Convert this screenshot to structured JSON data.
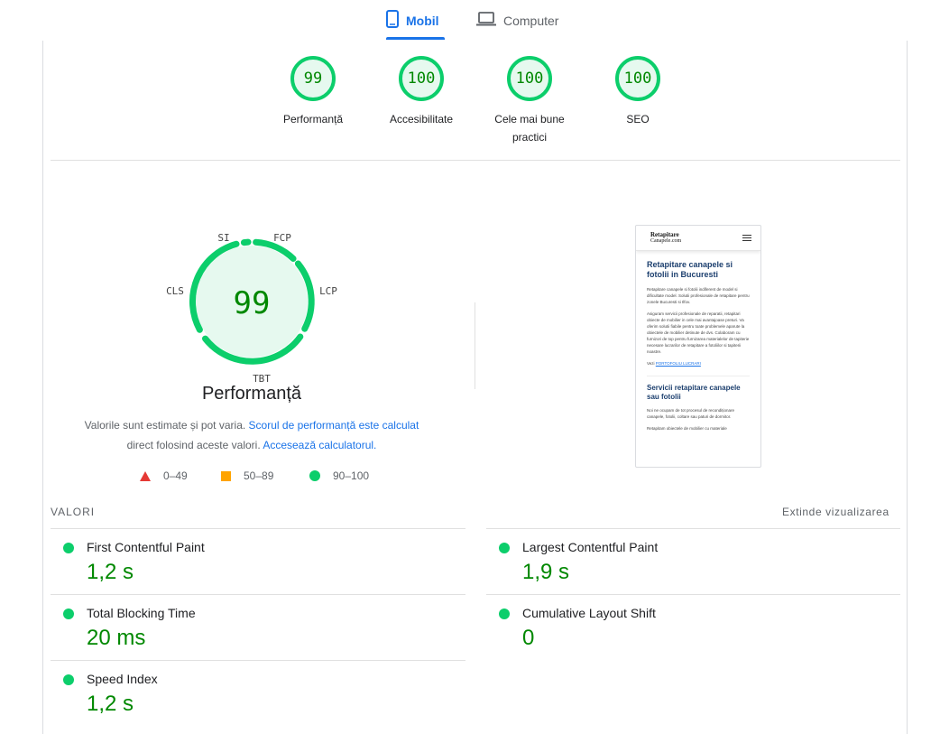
{
  "tabs": {
    "mobile": "Mobil",
    "desktop": "Computer"
  },
  "scores": [
    {
      "value": "99",
      "label": "Performanță"
    },
    {
      "value": "100",
      "label": "Accesibilitate"
    },
    {
      "value": "100",
      "label": "Cele mai bune practici"
    },
    {
      "value": "100",
      "label": "SEO"
    }
  ],
  "performance": {
    "score": "99",
    "title": "Performanță",
    "gauge_labels": {
      "si": "SI",
      "fcp": "FCP",
      "lcp": "LCP",
      "tbt": "TBT",
      "cls": "CLS"
    },
    "note_text": "Valorile sunt estimate și pot varia.",
    "note_link1": "Scorul de performanță este calculat",
    "note_text2": "direct folosind aceste valori.",
    "note_link2": "Accesează calculatorul."
  },
  "legend": {
    "bad": "0–49",
    "average": "50–89",
    "good": "90–100"
  },
  "colors": {
    "good": "#0cce6b",
    "average": "#ffa400",
    "bad": "#e53935",
    "accent": "#1a73e8"
  },
  "preview": {
    "logo_line1": "Retapitare",
    "logo_line2": "Canapele.com",
    "h1": "Retapitare canapele si fotolii in Bucuresti",
    "p1": "Retapitare canapele si fotolii indiferent de model si dificultate model. Solutii profesionale de retapitare pentru zonele Bucuresti si Ilfov.",
    "p2": "Asiguram servicii profesionale de reparatii, retapitari obiecte de mobilier in cele mai avantajoase preturi. Va oferim solutii fiabile pentru toate problemele aparute la obiectele de mobilier detinute de dvs. Colaboram cu furnizori de top pentru furnizarea materialelor de tapiterie necesare lucrarilor de retapitare a fotoliilor si tapiterii noastre.",
    "p3_prefix": "Vezi",
    "p3_link": "PORTOFOLIU LUCRARI",
    "h2": "Servicii retapitare canapele sau fotolii",
    "p4": "Noi ne ocupam de tot procesul de recondiționare canapele, fotolii, coltare sau paturi de dormitor.",
    "p5": "Retapitam obiectele de mobilier cu materiale"
  },
  "metrics_section": {
    "heading": "VALORI",
    "expand": "Extinde vizualizarea"
  },
  "metrics": [
    {
      "name": "First Contentful Paint",
      "value": "1,2 s"
    },
    {
      "name": "Largest Contentful Paint",
      "value": "1,9 s"
    },
    {
      "name": "Total Blocking Time",
      "value": "20 ms"
    },
    {
      "name": "Cumulative Layout Shift",
      "value": "0"
    },
    {
      "name": "Speed Index",
      "value": "1,2 s"
    }
  ]
}
